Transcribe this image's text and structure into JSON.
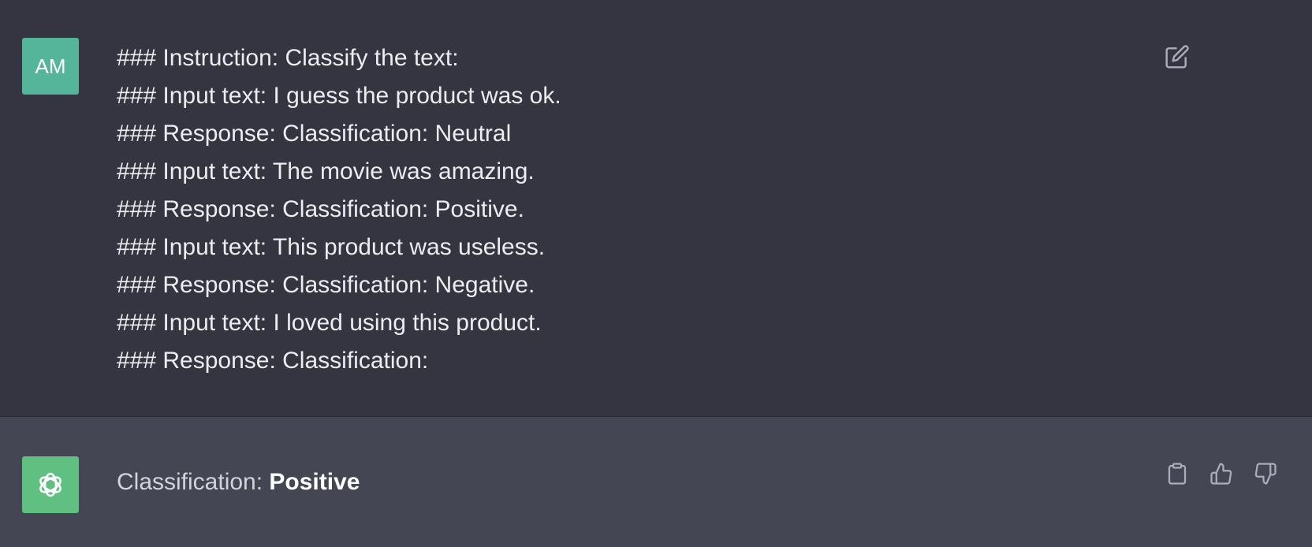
{
  "user_message": {
    "avatar_initials": "AM",
    "lines": [
      "### Instruction: Classify the text:",
      "### Input text: I guess the product was ok.",
      "### Response: Classification: Neutral",
      "### Input text: The movie was amazing.",
      "### Response: Classification: Positive.",
      "### Input text: This product was useless.",
      "### Response: Classification: Negative.",
      "### Input text: I loved using this product.",
      "### Response: Classification:"
    ],
    "edit_icon": "edit-icon"
  },
  "assistant_message": {
    "avatar_icon": "openai-logo-icon",
    "prefix": "Classification: ",
    "label": "Positive",
    "actions": [
      "copy-icon",
      "thumbs-up-icon",
      "thumbs-down-icon"
    ]
  },
  "colors": {
    "user_bg": "#343541",
    "assistant_bg": "#444654",
    "user_avatar": "#55b59b",
    "assistant_avatar": "#5fc082",
    "text": "#ececf1"
  }
}
